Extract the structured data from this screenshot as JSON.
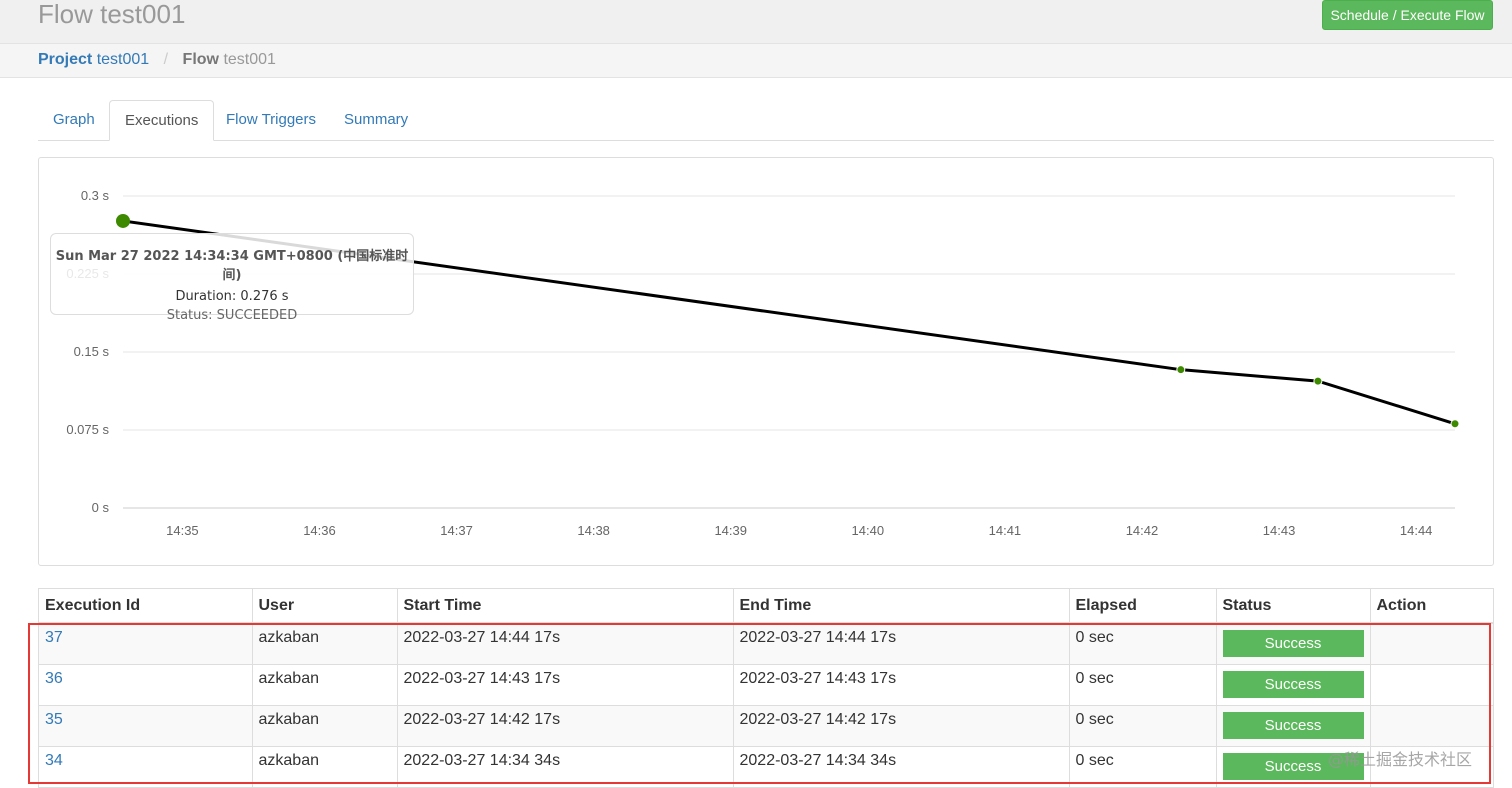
{
  "header": {
    "title": "Flow test001",
    "execute_button": "Schedule / Execute Flow"
  },
  "breadcrumb": {
    "project_key": "Project",
    "project_value": "test001",
    "separator": "/",
    "flow_key": "Flow",
    "flow_value": "test001"
  },
  "tabs": [
    {
      "label": "Graph",
      "active": false
    },
    {
      "label": "Executions",
      "active": true
    },
    {
      "label": "Flow Triggers",
      "active": false
    },
    {
      "label": "Summary",
      "active": false
    }
  ],
  "chart_data": {
    "type": "line",
    "y_tick_labels": [
      "0 s",
      "0.075 s",
      "0.15 s",
      "0.225 s",
      "0.3 s"
    ],
    "x_tick_labels": [
      "14:35",
      "14:36",
      "14:37",
      "14:38",
      "14:39",
      "14:40",
      "14:41",
      "14:42",
      "14:43",
      "14:44"
    ],
    "ylim": [
      0,
      0.3
    ],
    "xlim": [
      "14:34:34",
      "14:44:17"
    ],
    "series": [
      {
        "values": [
          {
            "x": "14:34:34",
            "y": 0.276
          },
          {
            "x": "14:42:17",
            "y": 0.133
          },
          {
            "x": "14:43:17",
            "y": 0.122
          },
          {
            "x": "14:44:17",
            "y": 0.081
          }
        ]
      }
    ],
    "line_color": "#000000",
    "point_color": "#3d8a00",
    "grid": true
  },
  "tooltip": {
    "date": "Sun Mar 27 2022 14:34:34 GMT+0800 (中国标准时间)",
    "duration": "Duration: 0.276 s",
    "status": "Status: SUCCEEDED"
  },
  "table": {
    "headers": [
      "Execution Id",
      "User",
      "Start Time",
      "End Time",
      "Elapsed",
      "Status",
      "Action"
    ],
    "rows": [
      {
        "id": "37",
        "user": "azkaban",
        "start": "2022-03-27 14:44 17s",
        "end": "2022-03-27 14:44 17s",
        "elapsed": "0 sec",
        "status": "Success"
      },
      {
        "id": "36",
        "user": "azkaban",
        "start": "2022-03-27 14:43 17s",
        "end": "2022-03-27 14:43 17s",
        "elapsed": "0 sec",
        "status": "Success"
      },
      {
        "id": "35",
        "user": "azkaban",
        "start": "2022-03-27 14:42 17s",
        "end": "2022-03-27 14:42 17s",
        "elapsed": "0 sec",
        "status": "Success"
      },
      {
        "id": "34",
        "user": "azkaban",
        "start": "2022-03-27 14:34 34s",
        "end": "2022-03-27 14:34 34s",
        "elapsed": "0 sec",
        "status": "Success"
      }
    ]
  },
  "watermark": "@稀土掘金技术社区",
  "colors": {
    "success": "#5cb85c",
    "link": "#337ab7",
    "highlight": "#e53935"
  }
}
